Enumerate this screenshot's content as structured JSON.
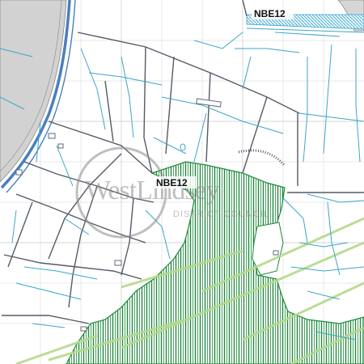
{
  "map": {
    "labels": {
      "zone_top": "NBE12",
      "zone_center": "NBE12"
    },
    "watermark": {
      "line1": "WestLindsey",
      "line2": "DISTRICT COUNCIL"
    },
    "colors": {
      "background": "#ffffff",
      "road_fill": "#cfcfcf",
      "river_edge": "#4a7fbf",
      "grid": "#c8c8c8",
      "field_boundary": "#555a66",
      "drain": "#3aa6c8",
      "designation_hatch": "#1e8a3c",
      "secondary_hatch": "#b5d98a",
      "label_text": "#111111",
      "watermark": "#8c8c8c"
    }
  }
}
